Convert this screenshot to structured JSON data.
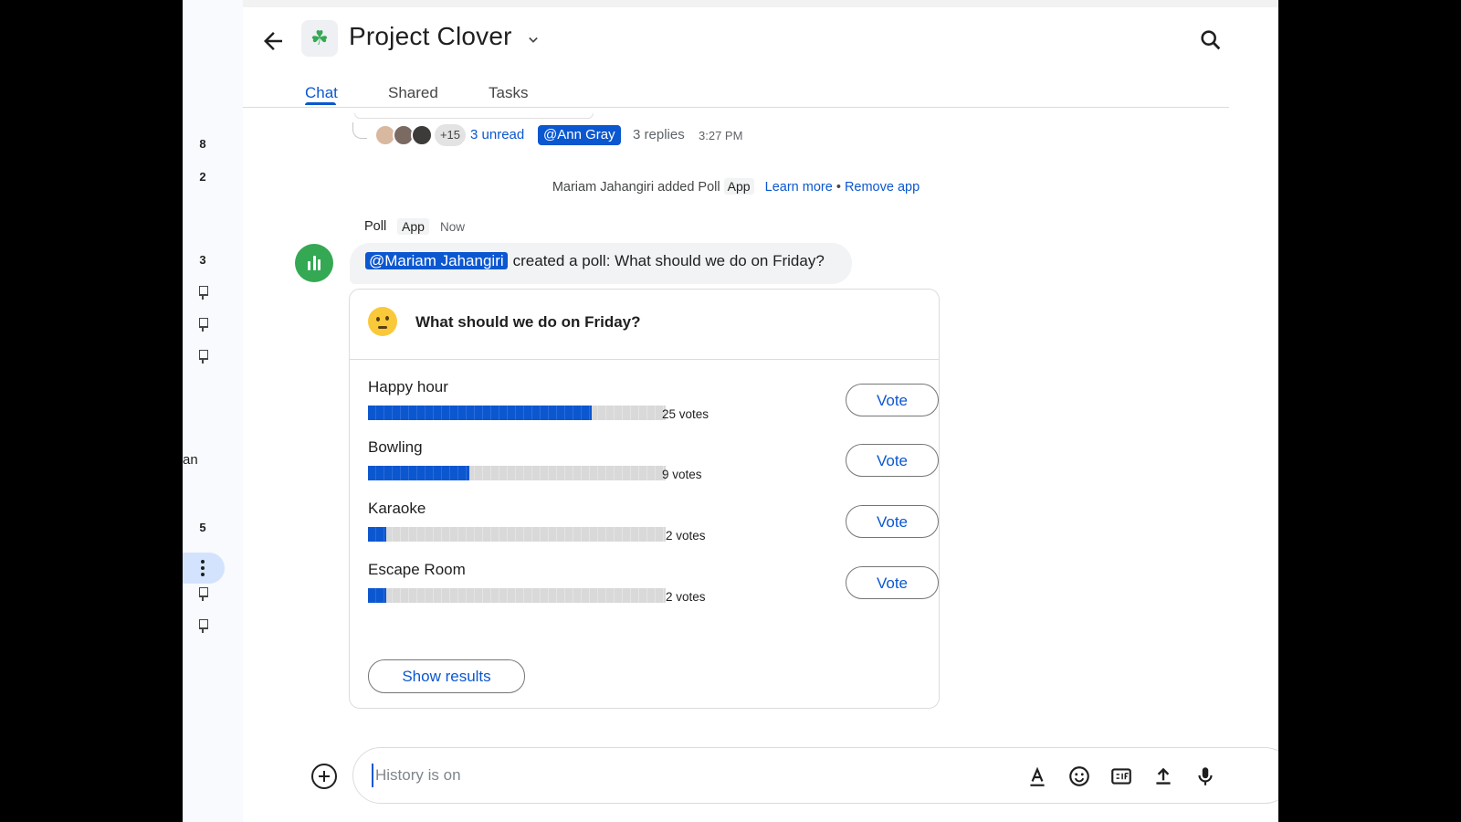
{
  "rail": {
    "numbers": [
      "8",
      "2",
      "3",
      "5"
    ],
    "partial_text": "an"
  },
  "header": {
    "title": "Project Clover",
    "space_icon": "☘",
    "tabs": [
      {
        "label": "Chat",
        "active": true
      },
      {
        "label": "Shared",
        "active": false
      },
      {
        "label": "Tasks",
        "active": false
      }
    ]
  },
  "thread": {
    "more_count": "+15",
    "unread": "3 unread",
    "mention": "@Ann Gray",
    "replies": "3 replies",
    "time": "3:27 PM"
  },
  "system_message": {
    "text": "Mariam Jahangiri added Poll",
    "app_chip": "App",
    "learn_more": "Learn more",
    "separator": "•",
    "remove_app": "Remove app"
  },
  "poll_message": {
    "sender": "Poll",
    "sender_chip": "App",
    "time": "Now",
    "mention": "@Mariam Jahangiri",
    "text": "created a poll: What should we do on Friday?",
    "card": {
      "question": "What should we do on Friday?",
      "options": [
        {
          "label": "Happy hour",
          "votes_text": "25 votes",
          "fraction": 0.75,
          "vote_label": "Vote"
        },
        {
          "label": "Bowling",
          "votes_text": "9 votes",
          "fraction": 0.34,
          "vote_label": "Vote"
        },
        {
          "label": "Karaoke",
          "votes_text": "2 votes",
          "fraction": 0.06,
          "vote_label": "Vote"
        },
        {
          "label": "Escape Room",
          "votes_text": "2 votes",
          "fraction": 0.06,
          "vote_label": "Vote"
        }
      ],
      "show_results_label": "Show results"
    }
  },
  "composer": {
    "placeholder": "History is on"
  },
  "colors": {
    "accent": "#0b57d0",
    "poll_green": "#34a853",
    "bar_track": "#d9d9d9"
  }
}
